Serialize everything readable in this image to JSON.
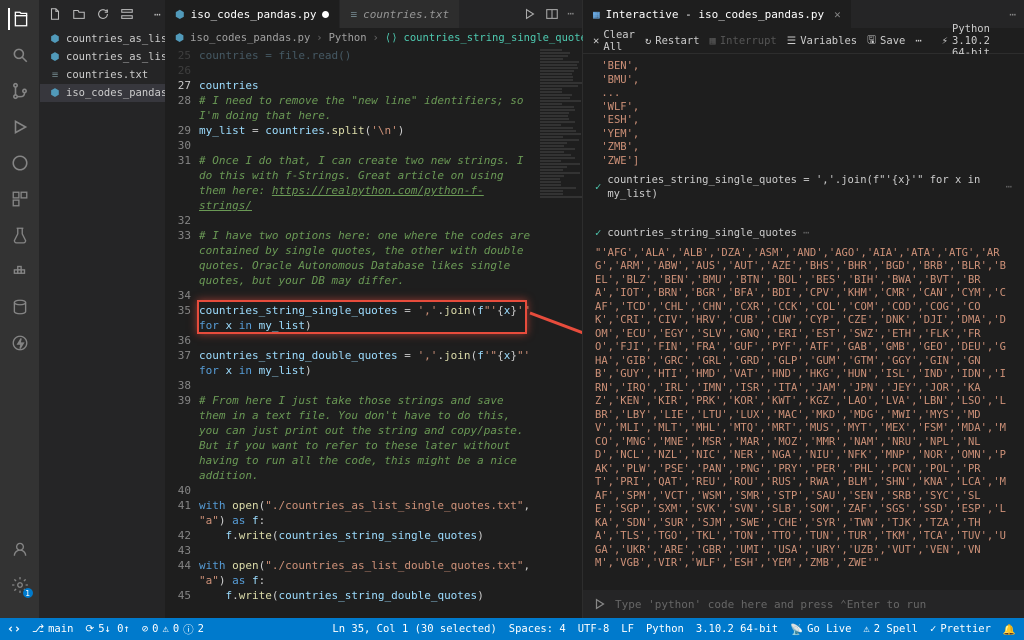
{
  "sidebar": {
    "files": [
      {
        "name": "countries_as_list_do...",
        "icon": "py"
      },
      {
        "name": "countries_as_list_si...",
        "icon": "py"
      },
      {
        "name": "countries.txt",
        "icon": "txt"
      },
      {
        "name": "iso_codes_pandas.py",
        "icon": "py",
        "active": true
      }
    ]
  },
  "tabs_left": [
    {
      "label": "iso_codes_pandas.py",
      "active": true,
      "dirty": true,
      "icon": "py"
    },
    {
      "label": "countries.txt",
      "italic": true,
      "icon": "txt"
    }
  ],
  "tabs_right": [
    {
      "label": "Interactive - iso_codes_pandas.py",
      "active": true,
      "icon": "interactive"
    }
  ],
  "breadcrumb": {
    "file": "iso_codes_pandas.py",
    "scope1": "Python",
    "scope2": "countries_string_single_quotes"
  },
  "code_prefix_lines": [
    "countries = file.read()",
    ""
  ],
  "code_start_line": 25,
  "code_lines": [
    {
      "n": 27,
      "t": "countries",
      "cls": "var current"
    },
    {
      "n": 28,
      "t": "# I need to remove the \"new line\" identifiers; so I'm doing that here.",
      "cls": "comment"
    },
    {
      "n": 29,
      "t": "my_list = countries.split('\\n')",
      "cls": "code"
    },
    {
      "n": 30,
      "t": "",
      "cls": ""
    },
    {
      "n": 31,
      "t": "# Once I do that, I can create two new strings. I do this with f-Strings. Great article on using them here: https://realpython.com/python-f-strings/",
      "cls": "comment link"
    },
    {
      "n": 32,
      "t": "",
      "cls": ""
    },
    {
      "n": 33,
      "t": "# I have two options here: one where the codes are contained by single quotes, the other with double quotes. Oracle Autonomous Database likes single quotes, but your DB may differ.",
      "cls": "comment"
    },
    {
      "n": 34,
      "t": "",
      "cls": ""
    },
    {
      "n": 35,
      "t": "countries_string_single_quotes = ','.join(f\"'{x}'\" for x in my_list)",
      "cls": "code highlight"
    },
    {
      "n": 36,
      "t": "",
      "cls": ""
    },
    {
      "n": 37,
      "t": "countries_string_double_quotes = ','.join(f'\"{x}\"' for x in my_list)",
      "cls": "code"
    },
    {
      "n": 38,
      "t": "",
      "cls": ""
    },
    {
      "n": 39,
      "t": "# From here I just take those strings and save them in a text file. You don't have to do this, you can just print out the string and copy/paste. But if you want to refer to these later without having to run all the code, this might be a nice addition.",
      "cls": "comment"
    },
    {
      "n": 40,
      "t": "",
      "cls": ""
    },
    {
      "n": 41,
      "t": "with open(\"./countries_as_list_single_quotes.txt\", \"a\") as f:",
      "cls": "code"
    },
    {
      "n": 42,
      "t": "    f.write(countries_string_single_quotes)",
      "cls": "code indent"
    },
    {
      "n": 43,
      "t": "",
      "cls": ""
    },
    {
      "n": 44,
      "t": "with open(\"./countries_as_list_double_quotes.txt\", \"a\") as f:",
      "cls": "code"
    },
    {
      "n": 45,
      "t": "    f.write(countries_string_double_quotes)",
      "cls": "code indent"
    }
  ],
  "interactive": {
    "toolbar": {
      "clear": "Clear All",
      "restart": "Restart",
      "interrupt": "Interrupt",
      "variables": "Variables",
      "save": "Save",
      "runtime": "Python 3.10.2 64-bit"
    },
    "top_output_lines": [
      "'BEN',",
      "'BMU',",
      "...",
      "'WLF',",
      "'ESH',",
      "'YEM',",
      "'ZMB',",
      "'ZWE']"
    ],
    "cell1_label": "countries_string_single_quotes = ','.join(f\"'{x}'\" for x in my_list)",
    "cell2_label": "countries_string_single_quotes",
    "cell2_output": "\"'AFG','ALA','ALB','DZA','ASM','AND','AGO','AIA','ATA','ATG','ARG','ARM','ABW','AUS','AUT','AZE','BHS','BHR','BGD','BRB','BLR','BEL','BLZ','BEN','BMU','BTN','BOL','BES','BIH','BWA','BVT','BRA','IOT','BRN','BGR','BFA','BDI','CPV','KHM','CMR','CAN','CYM','CAF','TCD','CHL','CHN','CXR','CCK','COL','COM','COD','COG','COK','CRI','CIV','HRV','CUB','CUW','CYP','CZE','DNK','DJI','DMA','DOM','ECU','EGY','SLV','GNQ','ERI','EST','SWZ','ETH','FLK','FRO','FJI','FIN','FRA','GUF','PYF','ATF','GAB','GMB','GEO','DEU','GHA','GIB','GRC','GRL','GRD','GLP','GUM','GTM','GGY','GIN','GNB','GUY','HTI','HMD','VAT','HND','HKG','HUN','ISL','IND','IDN','IRN','IRQ','IRL','IMN','ISR','ITA','JAM','JPN','JEY','JOR','KAZ','KEN','KIR','PRK','KOR','KWT','KGZ','LAO','LVA','LBN','LSO','LBR','LBY','LIE','LTU','LUX','MAC','MKD','MDG','MWI','MYS','MDV','MLI','MLT','MHL','MTQ','MRT','MUS','MYT','MEX','FSM','MDA','MCO','MNG','MNE','MSR','MAR','MOZ','MMR','NAM','NRU','NPL','NLD','NCL','NZL','NIC','NER','NGA','NIU','NFK','MNP','NOR','OMN','PAK','PLW','PSE','PAN','PNG','PRY','PER','PHL','PCN','POL','PRT','PRI','QAT','REU','ROU','RUS','RWA','BLM','SHN','KNA','LCA','MAF','SPM','VCT','WSM','SMR','STP','SAU','SEN','SRB','SYC','SLE','SGP','SXM','SVK','SVN','SLB','SOM','ZAF','SGS','SSD','ESP','LKA','SDN','SUR','SJM','SWE','CHE','SYR','TWN','TJK','TZA','THA','TLS','TGO','TKL','TON','TTO','TUN','TUR','TKM','TCA','TUV','UGA','UKR','ARE','GBR','UMI','USA','URY','UZB','VUT','VEN','VNM','VGB','VIR','WLF','ESH','YEM','ZMB','ZWE'\"",
    "repl_placeholder": "Type 'python' code here and press ⌃Enter to run"
  },
  "status": {
    "branch": "main",
    "sync": "5↓ 0↑",
    "errors": "0",
    "warnings": "0",
    "info": "2",
    "cursor": "Ln 35, Col 1 (30 selected)",
    "spaces": "Spaces: 4",
    "encoding": "UTF-8",
    "eol": "LF",
    "lang": "Python",
    "runtime": "3.10.2 64-bit",
    "golive": "Go Live",
    "spell": "2 Spell",
    "prettier": "Prettier"
  }
}
